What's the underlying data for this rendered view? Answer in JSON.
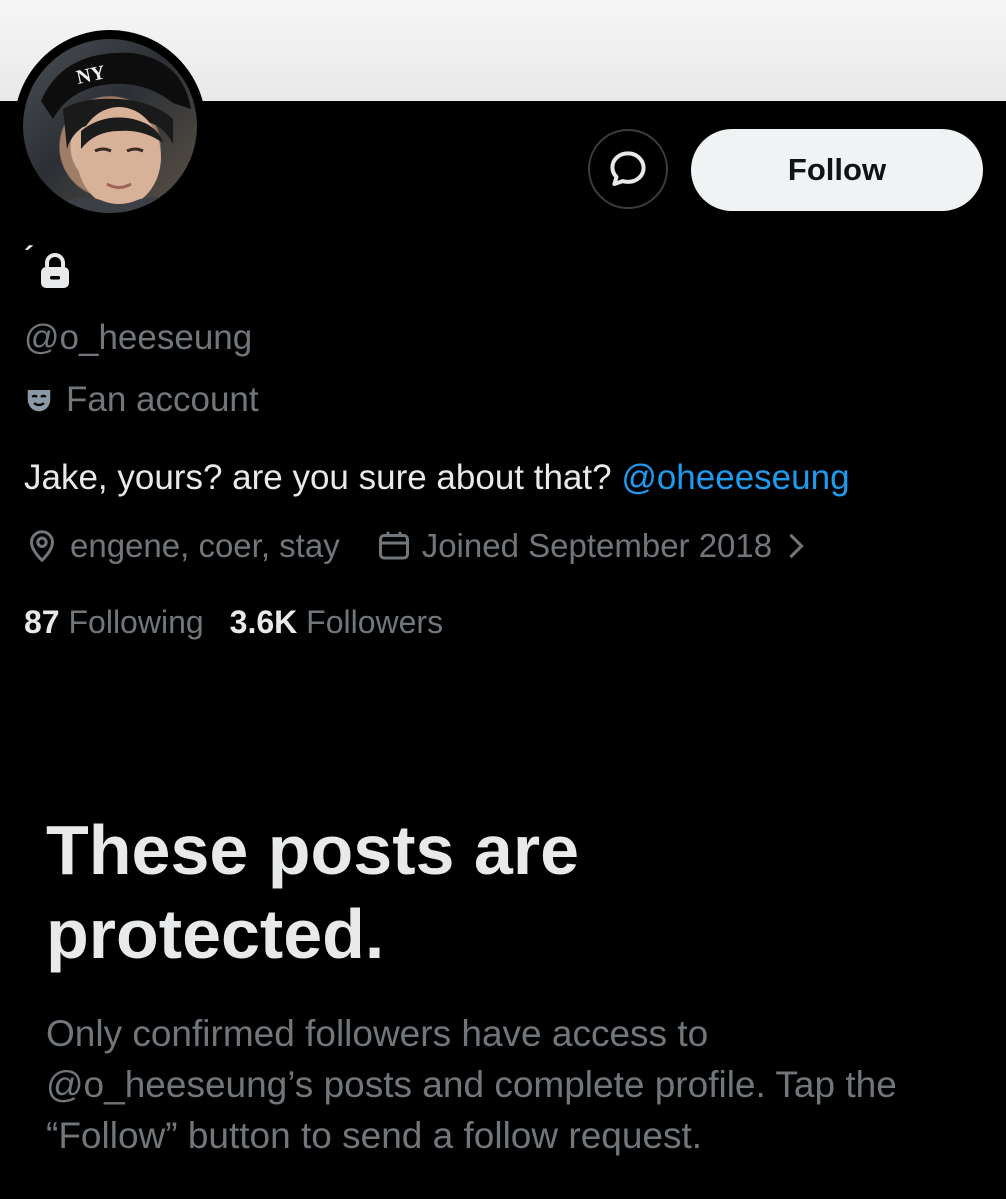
{
  "profile": {
    "display_name": "´",
    "handle": "@o_heeseung",
    "label": "Fan account",
    "bio_text": "Jake, yours? are you sure about that? ",
    "bio_mention": "@oheeeseung",
    "location": "engene, coer, stay",
    "joined": "Joined September 2018",
    "following_count": "87",
    "following_label": "Following",
    "followers_count": "3.6K",
    "followers_label": "Followers"
  },
  "actions": {
    "follow_label": "Follow"
  },
  "protected": {
    "title": "These posts are protected.",
    "description": "Only confirmed followers have access to @o_heeseung’s posts and complete profile. Tap the “Follow” button to send a follow request."
  },
  "icons": {
    "message": "message-bubble-icon",
    "lock": "lock-icon",
    "label": "mask-icon",
    "location": "location-pin-icon",
    "calendar": "calendar-icon",
    "chevron": "chevron-right-icon"
  },
  "colors": {
    "background": "#000000",
    "primary_text": "#e7e9ea",
    "secondary_text": "#71767b",
    "link": "#1d9bf0",
    "follow_button_bg": "#eff3f4"
  }
}
